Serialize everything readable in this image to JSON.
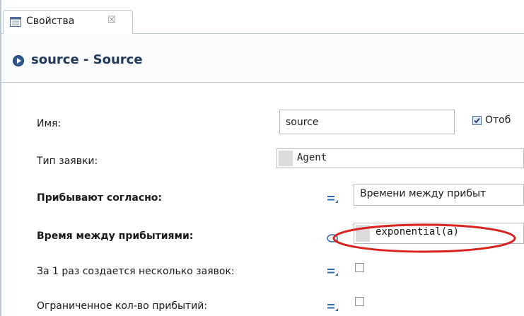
{
  "tab": {
    "label": "Свойства",
    "close_glyph": "☒"
  },
  "header": {
    "title": "source - Source",
    "icon": "run-arrow-icon"
  },
  "properties": {
    "name": {
      "label": "Имя:",
      "value": "source",
      "checkbox_label": "Отоб",
      "checked": true
    },
    "agent_type": {
      "label": "Тип заявки:",
      "value": "Agent"
    },
    "arrivals_defined_by": {
      "label": "Прибывают согласно:",
      "value": "Времени между прибыт"
    },
    "interarrival_time": {
      "label": "Время между прибытиями:",
      "value": "exponential(a)"
    },
    "multiple_per_arrival": {
      "label": "За 1 раз создается несколько заявок:",
      "checked": false
    },
    "limited_arrivals": {
      "label": "Ограниченное кол-во прибытий:",
      "checked": false
    }
  },
  "colors": {
    "accent": "#2e5b91",
    "header_title": "#203a5c",
    "highlight_ellipse": "#d9231c",
    "border": "#b9c6d6"
  }
}
